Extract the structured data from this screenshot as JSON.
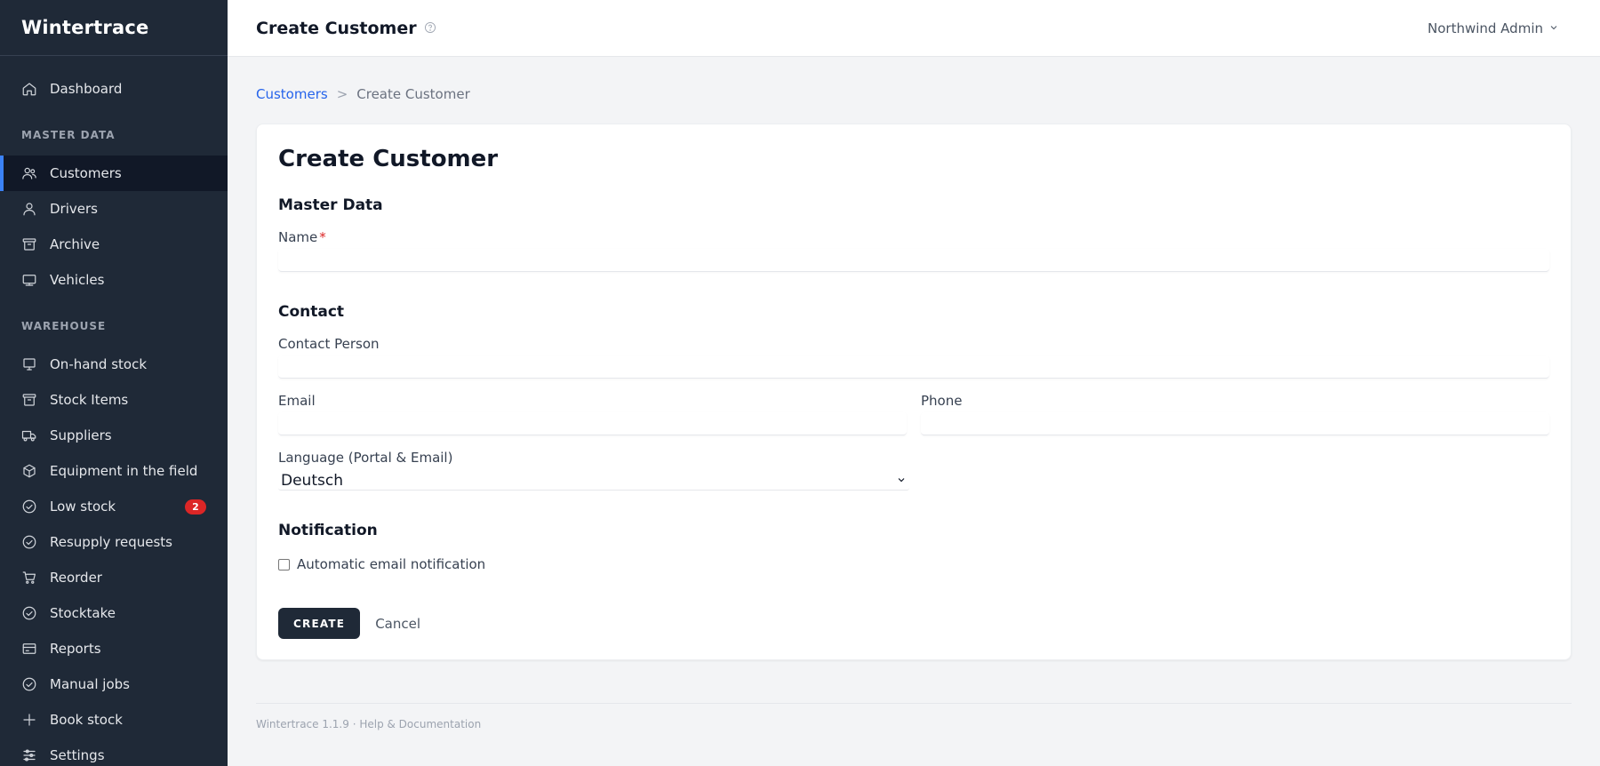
{
  "app": {
    "name": "Wintertrace"
  },
  "sidebar": {
    "top": [
      {
        "label": "Dashboard",
        "icon": "home-icon"
      }
    ],
    "sections": [
      {
        "title": "MASTER DATA",
        "items": [
          {
            "label": "Customers",
            "icon": "users-icon",
            "active": true
          },
          {
            "label": "Drivers",
            "icon": "user-icon"
          },
          {
            "label": "Archive",
            "icon": "archive-icon"
          },
          {
            "label": "Vehicles",
            "icon": "truck-icon"
          }
        ]
      },
      {
        "title": "WAREHOUSE",
        "items": [
          {
            "label": "On-hand stock",
            "icon": "monitor-icon"
          },
          {
            "label": "Stock Items",
            "icon": "archive-icon"
          },
          {
            "label": "Suppliers",
            "icon": "truck-icon"
          },
          {
            "label": "Equipment in the field",
            "icon": "cube-icon"
          },
          {
            "label": "Low stock",
            "icon": "check-circle-icon",
            "badge": "2"
          },
          {
            "label": "Resupply requests",
            "icon": "check-circle-icon"
          },
          {
            "label": "Reorder",
            "icon": "cart-icon"
          },
          {
            "label": "Stocktake",
            "icon": "check-circle-icon"
          },
          {
            "label": "Reports",
            "icon": "card-icon"
          },
          {
            "label": "Manual jobs",
            "icon": "check-circle-icon"
          },
          {
            "label": "Book stock",
            "icon": "plus-icon"
          },
          {
            "label": "Settings",
            "icon": "sliders-icon"
          }
        ]
      }
    ]
  },
  "header": {
    "title": "Create Customer",
    "user": "Northwind Admin"
  },
  "breadcrumb": {
    "parent": "Customers",
    "separator": ">",
    "current": "Create Customer"
  },
  "form": {
    "title": "Create Customer",
    "master_data": {
      "title": "Master Data",
      "name_label": "Name",
      "required_mark": "*",
      "name_value": ""
    },
    "contact": {
      "title": "Contact",
      "contact_person_label": "Contact Person",
      "email_label": "Email",
      "phone_label": "Phone",
      "language_label": "Language (Portal & Email)",
      "language_value": "Deutsch"
    },
    "notification": {
      "title": "Notification",
      "auto_email_label": "Automatic email notification",
      "auto_email_checked": false
    },
    "create_label": "CREATE",
    "cancel_label": "Cancel"
  },
  "footer": {
    "text": "Wintertrace 1.1.9 · Help & Documentation"
  },
  "colors": {
    "sidebar_bg": "#1f2937",
    "accent": "#3b82f6",
    "link": "#2563eb",
    "badge": "#dc2626"
  }
}
